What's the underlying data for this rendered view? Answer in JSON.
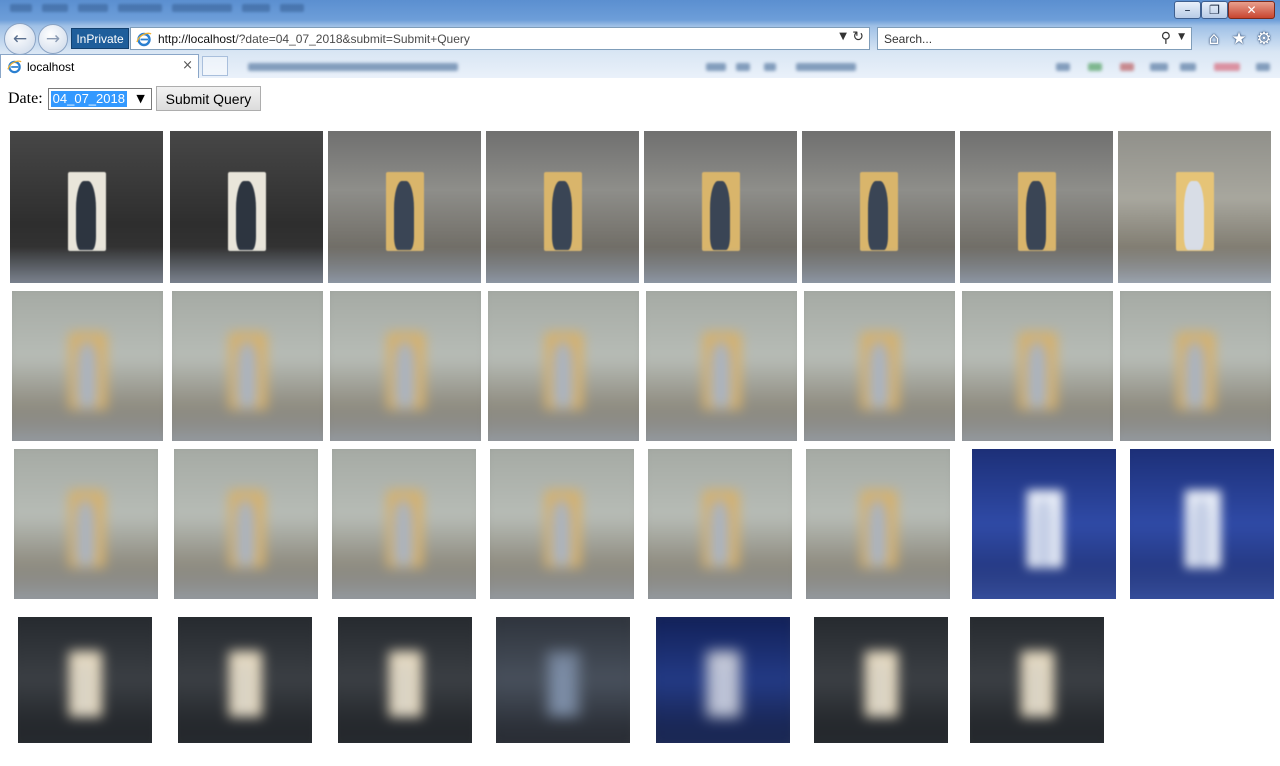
{
  "browser": {
    "inprivate_label": "InPrivate",
    "address": {
      "host": "http://localhost",
      "rest": "/?date=04_07_2018&submit=Submit+Query"
    },
    "search_placeholder": "Search...",
    "tab": {
      "label": "localhost",
      "close": "×"
    }
  },
  "form": {
    "date_label": "Date:",
    "date_selected": "04_07_2018",
    "submit_label": "Submit Query"
  },
  "thumbnails": [
    {
      "theme": "dark-sharp"
    },
    {
      "theme": "dark-sharp"
    },
    {
      "theme": "mid-sharp"
    },
    {
      "theme": "mid-sharp"
    },
    {
      "theme": "mid-sharp"
    },
    {
      "theme": "mid-sharp"
    },
    {
      "theme": "mid-sharp"
    },
    {
      "theme": "bright-sharp"
    },
    {
      "theme": "light-blur"
    },
    {
      "theme": "light-blur"
    },
    {
      "theme": "light-blur"
    },
    {
      "theme": "light-blur"
    },
    {
      "theme": "light-blur"
    },
    {
      "theme": "light-blur"
    },
    {
      "theme": "light-blur"
    },
    {
      "theme": "light-blur"
    },
    {
      "theme": "light-blur"
    },
    {
      "theme": "light-blur"
    },
    {
      "theme": "light-blur"
    },
    {
      "theme": "light-blur"
    },
    {
      "theme": "light-blur"
    },
    {
      "theme": "light-blur"
    },
    {
      "theme": "blue-night"
    },
    {
      "theme": "blue-night"
    },
    {
      "theme": "dark-blur"
    },
    {
      "theme": "dark-blur"
    },
    {
      "theme": "dark-blur"
    },
    {
      "theme": "dark-person"
    },
    {
      "theme": "blue-person"
    },
    {
      "theme": "dark-blur"
    },
    {
      "theme": "dark-blur"
    }
  ]
}
